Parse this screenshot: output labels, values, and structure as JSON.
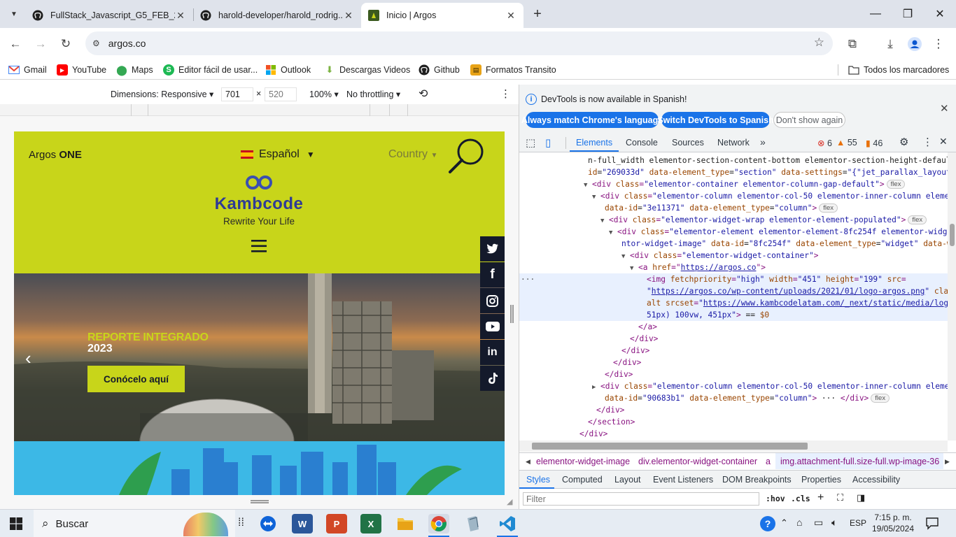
{
  "tabs": [
    {
      "title": "FullStack_Javascript_G5_FEB_20...",
      "icon": "github-icon"
    },
    {
      "title": "harold-developer/harold_rodrig...",
      "icon": "github-icon"
    },
    {
      "title": "Inicio | Argos",
      "icon": "argos-favicon-icon"
    }
  ],
  "address": {
    "url": "argos.co"
  },
  "bookmarks": [
    {
      "label": "Gmail",
      "icon": "gmail-icon"
    },
    {
      "label": "YouTube",
      "icon": "youtube-icon"
    },
    {
      "label": "Maps",
      "icon": "maps-icon"
    },
    {
      "label": "Editor fácil de usar...",
      "icon": "editor-icon"
    },
    {
      "label": "Outlook",
      "icon": "windows-icon"
    },
    {
      "label": "Descargas Videos",
      "icon": "download-leaf-icon"
    },
    {
      "label": "Github",
      "icon": "github-icon"
    },
    {
      "label": "Formatos Transito",
      "icon": "forms-icon"
    }
  ],
  "all_bookmarks": "Todos los marcadores",
  "device_toolbar": {
    "dimensions": "Dimensions: Responsive",
    "width": "701",
    "times": "×",
    "height": "520",
    "zoom": "100%",
    "throttling": "No throttling"
  },
  "site": {
    "brand_prefix": "Argos",
    "brand_bold": "ONE",
    "language": "Español",
    "country": "Country",
    "logo_name": "Kambcode",
    "tagline": "Rewrite Your Life",
    "hero_line1": "REPORTE INTEGRADO",
    "hero_line2": "2023",
    "hero_button": "Conócelo aquí",
    "social": [
      "twitter-icon",
      "facebook-icon",
      "instagram-icon",
      "youtube-icon",
      "linkedin-icon",
      "tiktok-icon"
    ]
  },
  "devtools": {
    "info_message": "DevTools is now available in Spanish!",
    "btn_match": "Always match Chrome's language",
    "btn_switch": "Switch DevTools to Spanish",
    "btn_dont": "Don't show again",
    "tabs": [
      "Elements",
      "Console",
      "Sources",
      "Network"
    ],
    "errors": "6",
    "warnings": "55",
    "issues": "46",
    "dom_lines": [
      {
        "prefix": "",
        "parts": [
          [
            "tx",
            "n-full_width elementor-section-content-bottom elementor-section-height-defaul"
          ]
        ]
      },
      {
        "prefix": "",
        "parts": [
          [
            "an",
            "id"
          ],
          [
            "tx",
            "="
          ],
          [
            "av",
            "\"269033d\""
          ],
          [
            "tx",
            " "
          ],
          [
            "an",
            "data-element_type"
          ],
          [
            "tx",
            "="
          ],
          [
            "av",
            "\"section\""
          ],
          [
            "tx",
            " "
          ],
          [
            "an",
            "data-settings"
          ],
          [
            "tx",
            "="
          ],
          [
            "av",
            "\"{\"jet_parallax_layout"
          ]
        ]
      },
      {
        "prefix": "▼",
        "parts": [
          [
            "tg",
            "<div "
          ],
          [
            "an",
            "class"
          ],
          [
            "tg",
            "="
          ],
          [
            "av",
            "\"elementor-container elementor-column-gap-default\""
          ],
          [
            "tg",
            ">"
          ]
        ],
        "badge": "flex"
      },
      {
        "prefix": "▼",
        "parts": [
          [
            "tg",
            "<div "
          ],
          [
            "an",
            "class"
          ],
          [
            "tg",
            "="
          ],
          [
            "av",
            "\"elementor-column elementor-col-50 elementor-inner-column eleme"
          ]
        ]
      },
      {
        "prefix": "",
        "parts": [
          [
            "an",
            "data-id"
          ],
          [
            "tx",
            "="
          ],
          [
            "av",
            "\"3e11371\""
          ],
          [
            "tx",
            " "
          ],
          [
            "an",
            "data-element_type"
          ],
          [
            "tx",
            "="
          ],
          [
            "av",
            "\"column\""
          ],
          [
            "tg",
            ">"
          ]
        ],
        "badge": "flex"
      },
      {
        "prefix": "▼",
        "parts": [
          [
            "tg",
            "<div "
          ],
          [
            "an",
            "class"
          ],
          [
            "tg",
            "="
          ],
          [
            "av",
            "\"elementor-widget-wrap elementor-element-populated\""
          ],
          [
            "tg",
            ">"
          ]
        ],
        "badge": "flex"
      },
      {
        "prefix": "▼",
        "parts": [
          [
            "tg",
            "<div "
          ],
          [
            "an",
            "class"
          ],
          [
            "tg",
            "="
          ],
          [
            "av",
            "\"elementor-element elementor-element-8fc254f elementor-widg"
          ]
        ]
      },
      {
        "prefix": "",
        "parts": [
          [
            "av",
            "ntor-widget-image\""
          ],
          [
            "tx",
            " "
          ],
          [
            "an",
            "data-id"
          ],
          [
            "tx",
            "="
          ],
          [
            "av",
            "\"8fc254f\""
          ],
          [
            "tx",
            " "
          ],
          [
            "an",
            "data-element_type"
          ],
          [
            "tx",
            "="
          ],
          [
            "av",
            "\"widget\""
          ],
          [
            "tx",
            " "
          ],
          [
            "an",
            "data-w"
          ]
        ]
      },
      {
        "prefix": "▼",
        "parts": [
          [
            "tg",
            "<div "
          ],
          [
            "an",
            "class"
          ],
          [
            "tg",
            "="
          ],
          [
            "av",
            "\"elementor-widget-container\""
          ],
          [
            "tg",
            ">"
          ]
        ]
      },
      {
        "prefix": "▼",
        "parts": [
          [
            "tg",
            "<a "
          ],
          [
            "an",
            "href"
          ],
          [
            "tg",
            "="
          ],
          [
            "tg",
            "\""
          ],
          [
            "lk",
            "https://argos.co"
          ],
          [
            "tg",
            "\">"
          ]
        ]
      },
      {
        "prefix": "",
        "parts": [
          [
            "tg",
            "<img "
          ],
          [
            "an",
            "fetchpriority"
          ],
          [
            "tg",
            "="
          ],
          [
            "av",
            "\"high\""
          ],
          [
            "tx",
            " "
          ],
          [
            "an",
            "width"
          ],
          [
            "tg",
            "="
          ],
          [
            "av",
            "\"451\""
          ],
          [
            "tx",
            " "
          ],
          [
            "an",
            "height"
          ],
          [
            "tg",
            "="
          ],
          [
            "av",
            "\"199\""
          ],
          [
            "tx",
            " "
          ],
          [
            "an",
            "src"
          ],
          [
            "tg",
            "="
          ]
        ]
      },
      {
        "prefix": "",
        "parts": [
          [
            "av",
            "\""
          ],
          [
            "lk",
            "https://argos.co/wp-content/uploads/2021/01/logo-argos.png"
          ],
          [
            "av",
            "\""
          ],
          [
            "tx",
            " "
          ],
          [
            "an",
            "clas"
          ]
        ]
      },
      {
        "prefix": "",
        "parts": [
          [
            "an",
            "alt"
          ],
          [
            "tx",
            " "
          ],
          [
            "an",
            "srcset"
          ],
          [
            "tg",
            "="
          ],
          [
            "av",
            "\""
          ],
          [
            "lk",
            "https://www.kambcodelatam.com/_next/static/media/logo"
          ]
        ]
      },
      {
        "prefix": "",
        "parts": [
          [
            "av",
            "51px) 100vw, 451px\""
          ],
          [
            "tg",
            ">"
          ],
          [
            "tx",
            " == "
          ],
          [
            "an",
            "$0"
          ]
        ]
      },
      {
        "prefix": "",
        "parts": [
          [
            "tg",
            "</a>"
          ]
        ]
      },
      {
        "prefix": "",
        "parts": [
          [
            "tg",
            "</div>"
          ]
        ]
      },
      {
        "prefix": "",
        "parts": [
          [
            "tg",
            "</div>"
          ]
        ]
      },
      {
        "prefix": "",
        "parts": [
          [
            "tg",
            "</div>"
          ]
        ]
      },
      {
        "prefix": "",
        "parts": [
          [
            "tg",
            "</div>"
          ]
        ]
      },
      {
        "prefix": "▶",
        "parts": [
          [
            "tg",
            "<div "
          ],
          [
            "an",
            "class"
          ],
          [
            "tg",
            "="
          ],
          [
            "av",
            "\"elementor-column elementor-col-50 elementor-inner-column eleme"
          ]
        ]
      },
      {
        "prefix": "",
        "parts": [
          [
            "an",
            "data-id"
          ],
          [
            "tx",
            "="
          ],
          [
            "av",
            "\"90683b1\""
          ],
          [
            "tx",
            " "
          ],
          [
            "an",
            "data-element_type"
          ],
          [
            "tx",
            "="
          ],
          [
            "av",
            "\"column\""
          ],
          [
            "tg",
            ">"
          ],
          [
            "tx",
            " ··· "
          ],
          [
            "tg",
            "</div>"
          ]
        ],
        "badge": "flex"
      },
      {
        "prefix": "",
        "parts": [
          [
            "tg",
            "</div>"
          ]
        ]
      },
      {
        "prefix": "",
        "parts": [
          [
            "tg",
            "</section>"
          ]
        ]
      },
      {
        "prefix": "",
        "parts": [
          [
            "tg",
            "</div>"
          ]
        ]
      }
    ],
    "breadcrumbs": [
      "elementor-widget-image",
      "div.elementor-widget-container",
      "a",
      "img.attachment-full.size-full.wp-image-36"
    ],
    "subtabs": [
      "Styles",
      "Computed",
      "Layout",
      "Event Listeners",
      "DOM Breakpoints",
      "Properties",
      "Accessibility"
    ],
    "filter_placeholder": "Filter",
    "hov": ":hov",
    "cls": ".cls"
  },
  "taskbar": {
    "search": "Buscar",
    "lang": "ESP",
    "time": "7:15 p. m.",
    "date": "19/05/2024"
  },
  "colors": {
    "site_lime": "#c8d51a",
    "site_navy": "#141a2b",
    "kambcode_blue": "#3a4fb0",
    "devtools_blue": "#1a73e8"
  }
}
